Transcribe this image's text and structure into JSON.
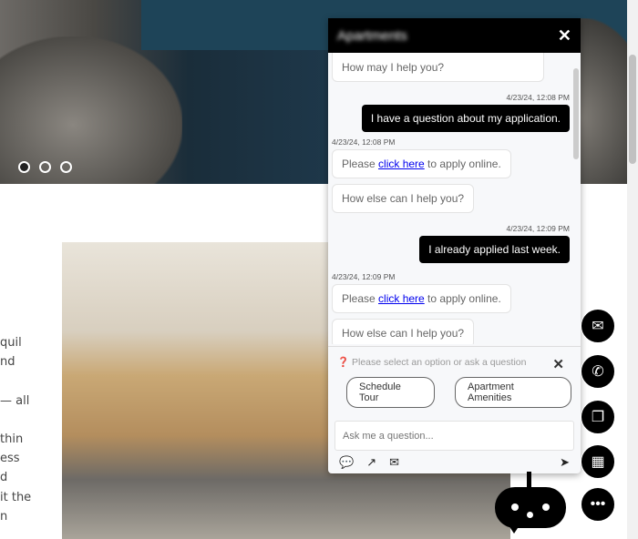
{
  "hero": {
    "slides": 3,
    "active_slide": 0
  },
  "side_text": [
    "quil",
    "nd",
    "",
    "— all",
    "",
    "thin",
    "ess",
    "d",
    "it the",
    "n"
  ],
  "chat": {
    "title": "Apartments",
    "messages": [
      {
        "from": "bot",
        "text": "How may I help you?"
      },
      {
        "from": "user",
        "time": "4/23/24, 12:08 PM",
        "text": "I have a question about my application."
      },
      {
        "from": "bot",
        "time": "4/23/24, 12:08 PM",
        "pre": "Please ",
        "link": "click here",
        "post": " to apply online."
      },
      {
        "from": "bot",
        "text": "How else can I help you?"
      },
      {
        "from": "user",
        "time": "4/23/24, 12:09 PM",
        "text": "I already applied last week."
      },
      {
        "from": "bot",
        "time": "4/23/24, 12:09 PM",
        "pre": "Please ",
        "link": "click here",
        "post": " to apply online."
      },
      {
        "from": "bot",
        "text": "How else can I help you?"
      }
    ],
    "hint": "Please select an option or ask a question",
    "options": [
      "Schedule Tour",
      "Apartment Amenities"
    ],
    "input_placeholder": "Ask me a question..."
  },
  "fabs": [
    "email-icon",
    "phone-icon",
    "copy-icon",
    "calendar-icon",
    "more-icon"
  ]
}
